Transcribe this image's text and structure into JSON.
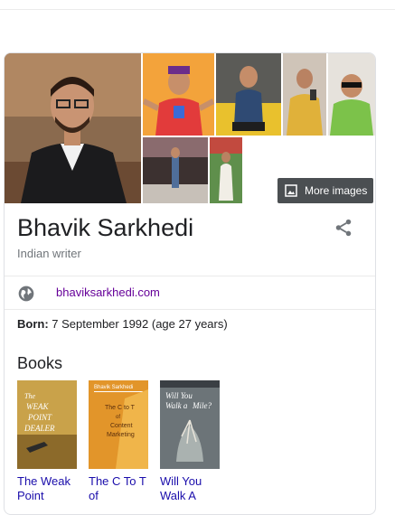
{
  "panel": {
    "more_images_label": "More images",
    "name": "Bhavik Sarkhedi",
    "subtitle": "Indian writer",
    "website": "bhaviksarkhedi.com",
    "born_label": "Born:",
    "born_value": "7 September 1992 (age 27 years)",
    "books_heading": "Books",
    "books": [
      {
        "title_line1": "The Weak",
        "title_line2": "Point",
        "cover_text": [
          "The",
          "WEAK",
          "POINT",
          "DEALER"
        ]
      },
      {
        "title_line1": "The C To T",
        "title_line2": "of",
        "cover_text": [
          "Bhavik Sarkhedi",
          "The C to T",
          "of",
          "Content",
          "Marketing"
        ]
      },
      {
        "title_line1": "Will You",
        "title_line2": "Walk A",
        "cover_text": [
          "Will You",
          "Walk a",
          "Mile?"
        ]
      }
    ]
  },
  "colors": {
    "link": "#1a0dab",
    "visited_link": "#660099",
    "muted": "#70757a"
  }
}
